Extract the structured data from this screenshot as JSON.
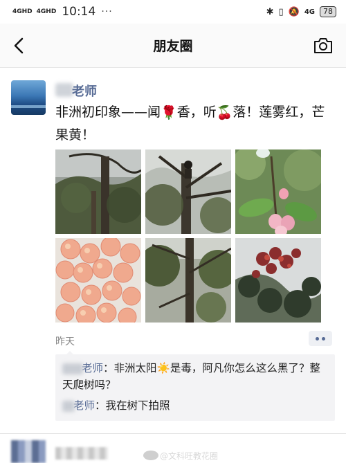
{
  "status_bar": {
    "signal_1": "4GHD",
    "signal_2": "4GHD",
    "time": "10:14",
    "dots": "···",
    "network": "4G",
    "battery": "78"
  },
  "nav": {
    "title": "朋友圈",
    "back_icon": "chevron-left-icon",
    "camera_icon": "camera-icon"
  },
  "post": {
    "author": "老师",
    "text_1": "非洲初印象——闻",
    "text_2": "香，听",
    "text_3": "落！莲雾红，芒果黄！",
    "emoji_1": "🌹",
    "emoji_2": "🍒",
    "photos": [
      "tree-trunk",
      "man-climbing-tree",
      "wax-apple-on-branch",
      "basket-of-wax-apples",
      "tree-branches",
      "red-blossom-tree"
    ],
    "time": "昨天",
    "more_icon": "two-dots-icon"
  },
  "comments": [
    {
      "author": "老师",
      "prefix": "：",
      "text": "非洲太阳",
      "emoji": "☀️",
      "text_2": "是毒，阿凡你怎么这么黑了？整天爬树吗？"
    },
    {
      "author": "老师",
      "prefix": "：",
      "text": "我在树下拍照"
    }
  ],
  "watermark": "@文科旺教花圈"
}
